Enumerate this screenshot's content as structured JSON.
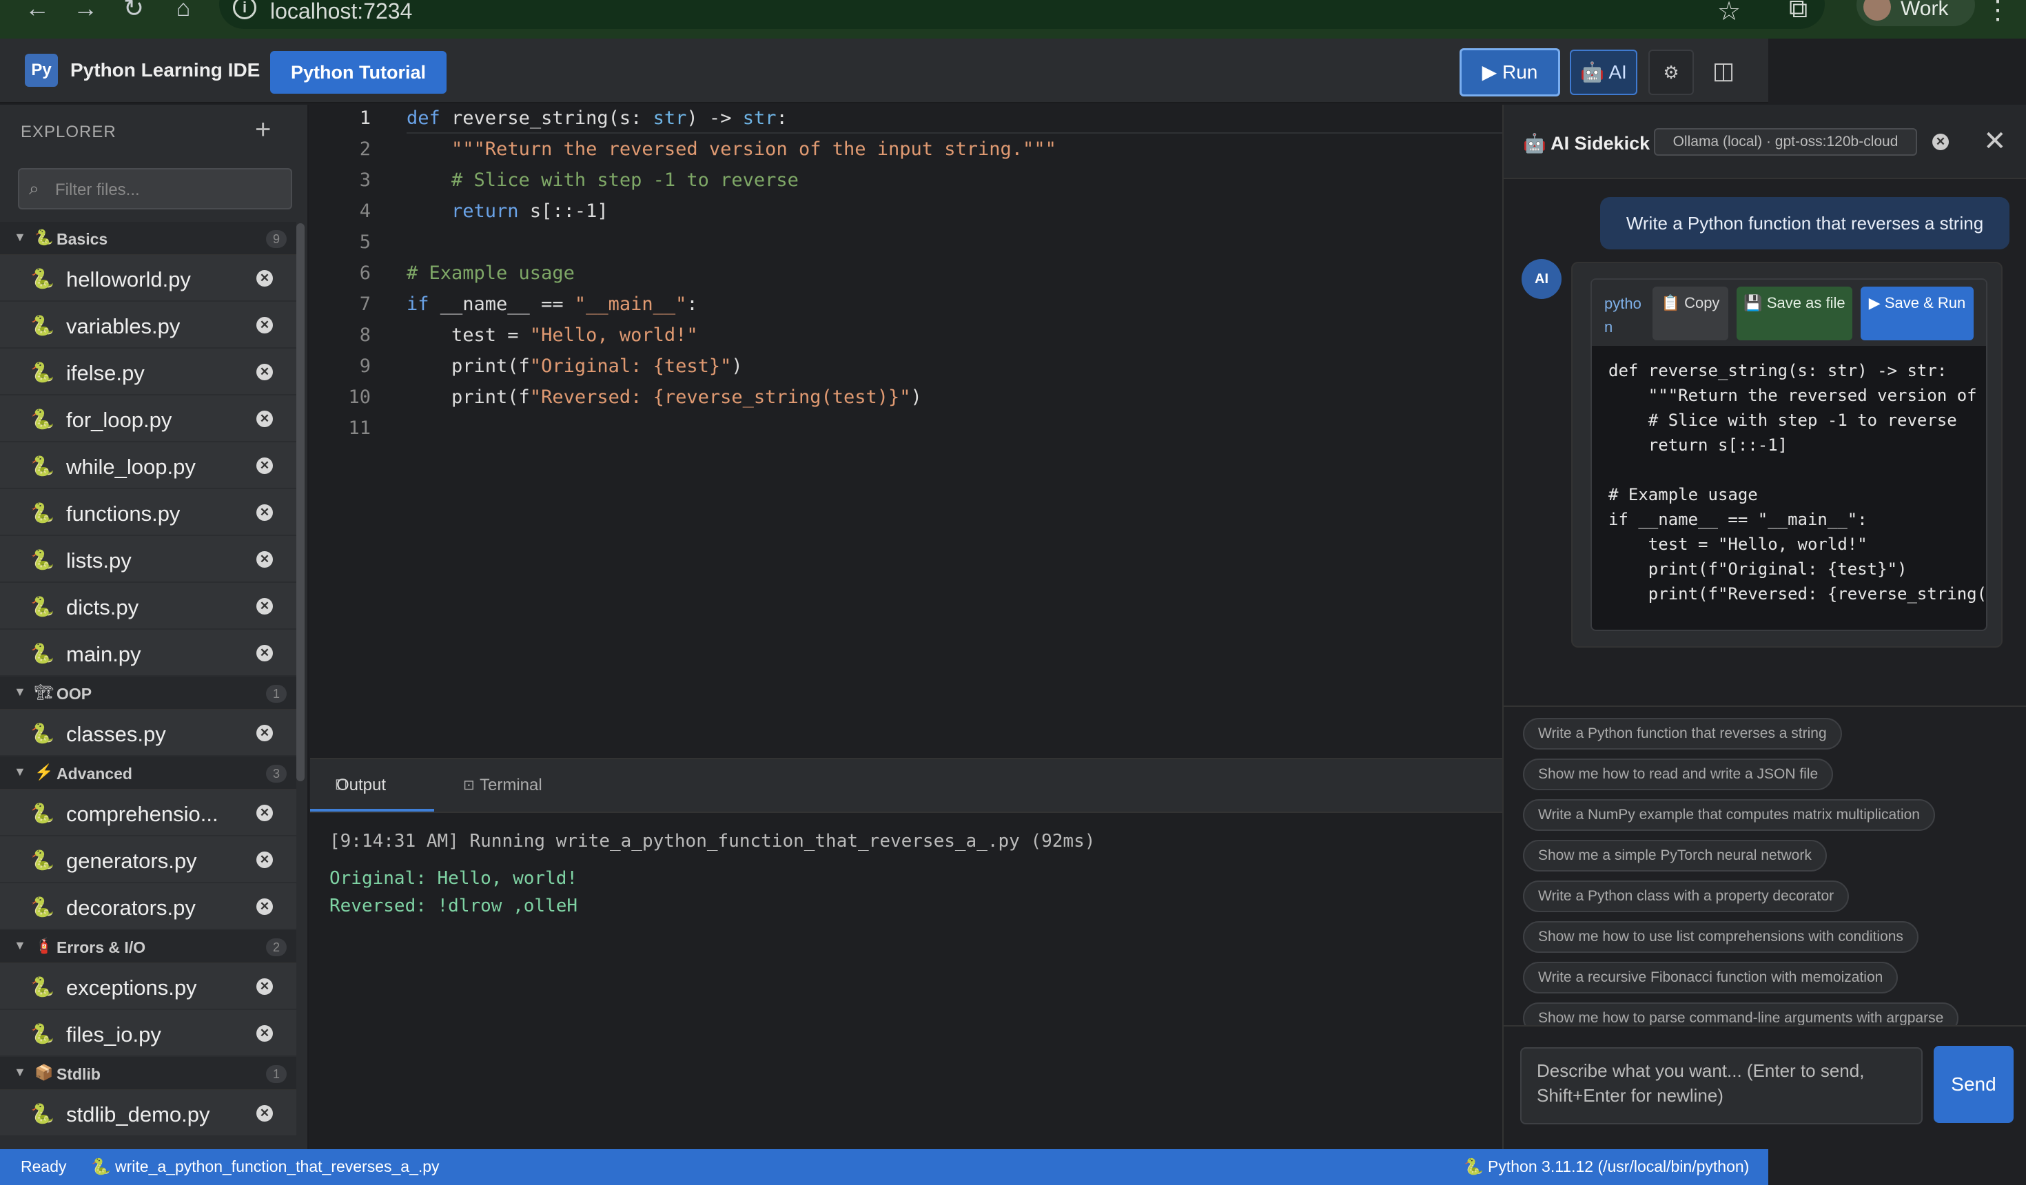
{
  "browser": {
    "url": "localhost:7234",
    "profile": "Work"
  },
  "header": {
    "logo": "Py",
    "title": "Python Learning IDE",
    "tutorial_label": "Python Tutorial",
    "run_label": "▶ Run",
    "ai_label": "🤖 AI",
    "settings_label": "⚙",
    "layout_label": "◫"
  },
  "sidebar": {
    "title": "EXPLORER",
    "filter_placeholder": "Filter files...",
    "groups": [
      {
        "name": "Basics",
        "icon": "🐍",
        "count": "9",
        "files": [
          "helloworld.py",
          "variables.py",
          "ifelse.py",
          "for_loop.py",
          "while_loop.py",
          "functions.py",
          "lists.py",
          "dicts.py",
          "main.py"
        ]
      },
      {
        "name": "OOP",
        "icon": "🏗",
        "count": "1",
        "files": [
          "classes.py"
        ]
      },
      {
        "name": "Advanced",
        "icon": "⚡",
        "count": "3",
        "files": [
          "comprehensio...",
          "generators.py",
          "decorators.py"
        ]
      },
      {
        "name": "Errors & I/O",
        "icon": "🧯",
        "count": "2",
        "files": [
          "exceptions.py",
          "files_io.py"
        ]
      },
      {
        "name": "Stdlib",
        "icon": "📦",
        "count": "1",
        "files": [
          "stdlib_demo.py"
        ]
      }
    ]
  },
  "editor": {
    "lines": [
      "def reverse_string(s: str) -> str:",
      "    \"\"\"Return the reversed version of the input string.\"\"\"",
      "    # Slice with step -1 to reverse",
      "    return s[::-1]",
      "",
      "# Example usage",
      "if __name__ == \"__main__\":",
      "    test = \"Hello, world!\"",
      "    print(f\"Original: {test}\")",
      "    print(f\"Reversed: {reverse_string(test)}\")",
      ""
    ]
  },
  "panel": {
    "tab_output": "Output",
    "tab_terminal": "Terminal",
    "run_line": "[9:14:31 AM] Running write_a_python_function_that_reverses_a_.py (92ms)",
    "out_line1": "Original: Hello, world!",
    "out_line2": "Reversed: !dlrow ,olleH"
  },
  "ai": {
    "title": "🤖 AI Sidekick",
    "model": "Ollama (local) · gpt-oss:120b-cloud",
    "user_message": "Write a Python function that reverses a string",
    "avatar": "AI",
    "code_lang": "python",
    "copy_label": "📋 Copy",
    "save_file_label": "💾 Save as file",
    "save_run_label": "▶ Save & Run",
    "code_lines": [
      "def reverse_string(s: str) -> str:",
      "    \"\"\"Return the reversed version of the input string.\"\"\"",
      "    # Slice with step -1 to reverse",
      "    return s[::-1]",
      "",
      "# Example usage",
      "if __name__ == \"__main__\":",
      "    test = \"Hello, world!\"",
      "    print(f\"Original: {test}\")",
      "    print(f\"Reversed: {reverse_string(test)}\")"
    ],
    "suggestions": [
      "Write a Python function that reverses a string",
      "Show me how to read and write a JSON file",
      "Write a NumPy example that computes matrix multiplication",
      "Show me a simple PyTorch neural network",
      "Write a Python class with a property decorator",
      "Show me how to use list comprehensions with conditions",
      "Write a recursive Fibonacci function with memoization",
      "Show me how to parse command-line arguments with argparse"
    ],
    "prompt_placeholder": "Describe what you want... (Enter to send, Shift+Enter for newline)",
    "send_label": "Send"
  },
  "status": {
    "ready": "Ready",
    "file": "🐍 write_a_python_function_that_reverses_a_.py",
    "python": "🐍 Python 3.11.12 (/usr/local/bin/python)"
  }
}
